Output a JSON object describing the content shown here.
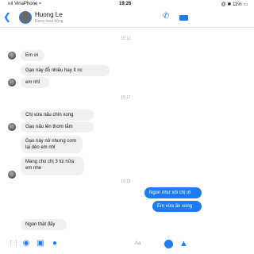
{
  "status_bar": {
    "carrier": "ıııl VinaPhone ≈",
    "time": "19:26",
    "battery": "@ ✱ 11% ▭"
  },
  "header": {
    "name": "Huong Le",
    "status": "Đang hoạt động"
  },
  "timestamps": [
    "15:12",
    "15:17",
    "15:19"
  ],
  "messages": [
    {
      "side": "them",
      "text": "Em ơi"
    },
    {
      "side": "them",
      "text": "Gạo này đỗ nhiều hay ít nc"
    },
    {
      "side": "them",
      "text": "em nhỉ"
    },
    {
      "side": "them",
      "text": "Chị vừa nấu chín xong"
    },
    {
      "side": "them",
      "text": "Gạo nấu lên thơm lắm"
    },
    {
      "side": "them",
      "text": "Gạo này nở nhưng cơm lại dẻo em nhỉ"
    },
    {
      "side": "them",
      "text": "Mang cho chị 3 túi nữa em nhe"
    },
    {
      "side": "me",
      "text": "Ngon như xôi chị ơi"
    },
    {
      "side": "me",
      "text": "Em vừa ăn xong"
    },
    {
      "side": "them",
      "text": "Ngon thật đấy"
    }
  ],
  "composer": {
    "aa_label": "Aa"
  },
  "icons": [
    "back-arrow-icon",
    "phone-icon",
    "video-icon",
    "apps-icon",
    "camera-icon",
    "photo-icon",
    "mic-icon",
    "emoji-icon",
    "like-icon"
  ],
  "colors": {
    "accent": "#1e7cf2",
    "incoming_bubble": "#f0f0f0"
  }
}
